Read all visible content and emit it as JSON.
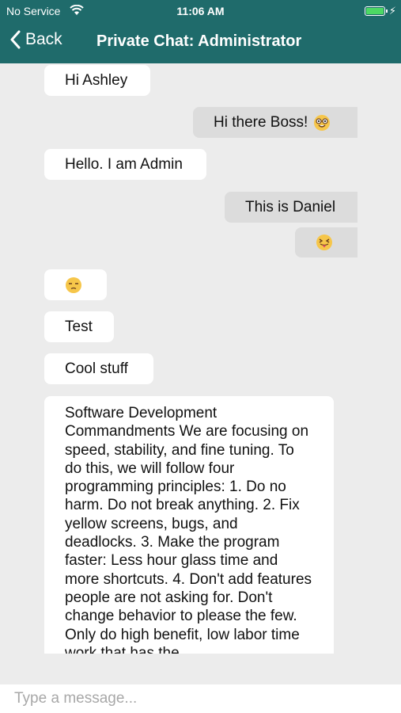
{
  "status_bar": {
    "carrier": "No Service",
    "time": "11:06 AM",
    "battery_level": 1.0
  },
  "nav": {
    "back_label": "Back",
    "title": "Private Chat: Administrator"
  },
  "messages": [
    {
      "side": "incoming",
      "text": "Hi Ashley"
    },
    {
      "side": "outgoing",
      "text": "Hi there Boss!",
      "emoji": "nerd-face"
    },
    {
      "side": "incoming",
      "text": "Hello. I am Admin"
    },
    {
      "side": "outgoing",
      "text": "This is Daniel"
    },
    {
      "side": "outgoing",
      "text": "",
      "emoji": "squinting-tongue-face"
    },
    {
      "side": "incoming",
      "text": "",
      "emoji": "unamused-face"
    },
    {
      "side": "incoming",
      "text": "Test"
    },
    {
      "side": "incoming",
      "text": "Cool stuff"
    },
    {
      "side": "incoming",
      "text": "Software Development Commandments We are focusing on speed, stability, and fine tuning. To do this, we will follow four programming principles: 1. Do no harm. Do not break anything. 2. Fix yellow screens, bugs, and deadlocks. 3. Make the program faster: Less hour glass time and more shortcuts. 4. Don't add features people are not asking for. Don't change behavior to please the few. Only do high benefit, low labor time work that has the"
    }
  ],
  "composer": {
    "placeholder": "Type a message..."
  },
  "colors": {
    "header": "#1f6b6b",
    "incoming_bubble": "#ffffff",
    "outgoing_bubble": "#dcdcdc",
    "background": "#ececec",
    "battery": "#4cd964"
  }
}
